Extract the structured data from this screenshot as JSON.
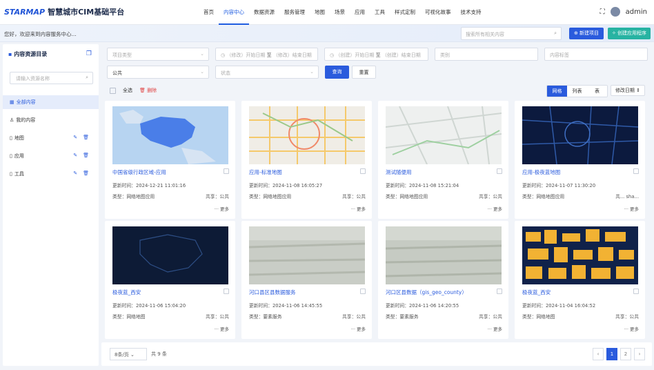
{
  "app": {
    "logo_text": "STARMAP",
    "title": "智慧城市CIM基础平台"
  },
  "nav": {
    "items": [
      "首页",
      "内容中心",
      "数据资源",
      "服务管理",
      "地图",
      "场景",
      "应用",
      "工具",
      "样式定制",
      "可视化故事",
      "技术支持"
    ],
    "active_index": 1
  },
  "user": {
    "name": "admin"
  },
  "subbar": {
    "welcome": "您好，欢迎来到内容服务中心...",
    "search_placeholder": "搜索所有相关内容",
    "new_project": "新建项目",
    "create_app": "创建应用程序"
  },
  "sidebar": {
    "title": "内容资源目录",
    "search_placeholder": "请输入资源名称",
    "items": [
      {
        "label": "全部内容",
        "icon": "grid-icon"
      },
      {
        "label": "我的内容",
        "icon": "user-icon"
      },
      {
        "label": "地图",
        "icon": "file-icon"
      },
      {
        "label": "应用",
        "icon": "file-icon"
      },
      {
        "label": "工具",
        "icon": "file-icon"
      }
    ]
  },
  "filters": {
    "type_placeholder": "项目类型",
    "modify_start": "（修改）开始日期",
    "modify_to": "至",
    "modify_end": "（修改）结束日期",
    "create_start": "（创建）开始日期",
    "create_to": "至",
    "create_end": "（创建）结束日期",
    "category_placeholder": "类别",
    "tags_placeholder": "内容标签",
    "share_value": "公共",
    "status_placeholder": "状态",
    "query": "查询",
    "reset": "重置"
  },
  "toolbar": {
    "select_all": "全选",
    "delete": "删除",
    "views": [
      "网格",
      "列表",
      "表"
    ],
    "sort": "修改日期"
  },
  "cards": [
    {
      "title": "中国省级行政区域-应用",
      "time": "更新时间：2024-12-21 11:01:16",
      "type": "类型：网络地图应用",
      "share": "共享：公共",
      "more": "··· 更多"
    },
    {
      "title": "应用-标准地图",
      "time": "更新时间：2024-11-08 16:05:27",
      "type": "类型：网络地图应用",
      "share": "共享：公共",
      "more": "··· 更多"
    },
    {
      "title": "测试随便用",
      "time": "更新时间：2024-11-08 15:21:04",
      "type": "类型：网络地图应用",
      "share": "共享：公共",
      "more": "··· 更多"
    },
    {
      "title": "应用-极夜蓝地图",
      "time": "更新时间：2024-11-07 11:30:20",
      "type": "类型：网络地图应用",
      "share": "共... sha...",
      "more": "··· 更多"
    },
    {
      "title": "极夜蓝_西安",
      "time": "更新时间：2024-11-06 15:04:20",
      "type": "类型：网络地图",
      "share": "共享：公共",
      "more": "··· 更多"
    },
    {
      "title": "河口县区县数据服务",
      "time": "更新时间：2024-11-06 14:45:55",
      "type": "类型：要素服务",
      "share": "共享：公共",
      "more": "··· 更多"
    },
    {
      "title": "河口区县数据（gis_geo_county）",
      "time": "更新时间：2024-11-06 14:20:55",
      "type": "类型：要素服务",
      "share": "共享：公共",
      "more": "··· 更多"
    },
    {
      "title": "极夜蓝_西安",
      "time": "更新时间：2024-11-04 16:04:52",
      "type": "类型：网络地图",
      "share": "共享：公共",
      "more": "··· 更多"
    }
  ],
  "footer": {
    "page_size": "8条/页",
    "total": "共 9 条",
    "pages": [
      "1",
      "2"
    ],
    "current_page": 1
  },
  "colors": {
    "accent": "#2a5bdd",
    "teal": "#27b3a2"
  }
}
